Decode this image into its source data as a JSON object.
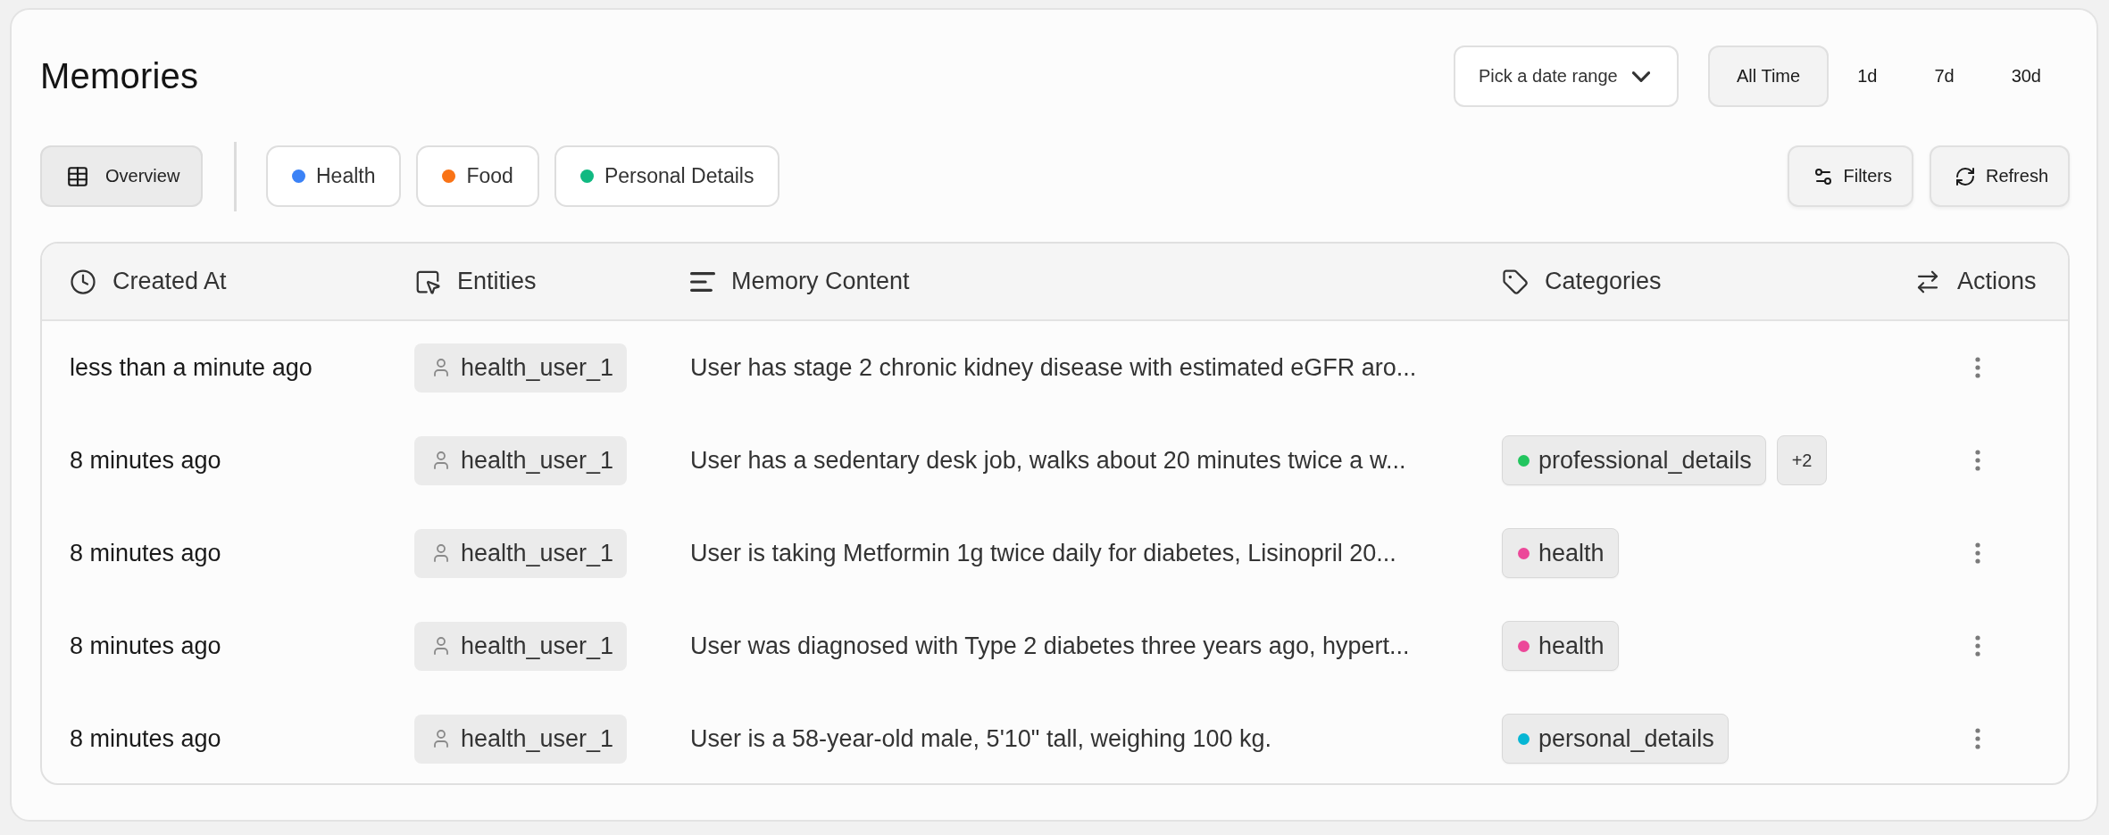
{
  "header": {
    "title": "Memories",
    "date_picker": {
      "placeholder": "Pick a date range"
    },
    "time_ranges": [
      {
        "label": "All Time",
        "selected": true
      },
      {
        "label": "1d",
        "selected": false
      },
      {
        "label": "7d",
        "selected": false
      },
      {
        "label": "30d",
        "selected": false
      }
    ]
  },
  "toolbar": {
    "overview": {
      "label": "Overview",
      "selected": true
    },
    "category_filters": [
      {
        "label": "Health",
        "color": "#3b82f6",
        "selected": false
      },
      {
        "label": "Food",
        "color": "#f97316",
        "selected": false
      },
      {
        "label": "Personal Details",
        "color": "#10b981",
        "selected": false
      }
    ],
    "actions": [
      {
        "kind": "filters",
        "label": "Filters"
      },
      {
        "kind": "refresh",
        "label": "Refresh"
      }
    ]
  },
  "table": {
    "columns": [
      {
        "kind": "time",
        "label": "Created At"
      },
      {
        "kind": "entity",
        "label": "Entities"
      },
      {
        "kind": "content",
        "label": "Memory Content"
      },
      {
        "kind": "category",
        "label": "Categories"
      },
      {
        "kind": "actions",
        "label": "Actions"
      }
    ],
    "rows": [
      {
        "created_at": "less than a minute ago",
        "entity": "health_user_1",
        "content": "User has stage 2 chronic kidney disease with estimated eGFR aro..."
      },
      {
        "created_at": "8 minutes ago",
        "entity": "health_user_1",
        "content": "User has a sedentary desk job, walks about 20 minutes twice a w...",
        "categories": [
          {
            "label": "professional_details",
            "color": "#22c55e"
          }
        ],
        "more": "+2"
      },
      {
        "created_at": "8 minutes ago",
        "entity": "health_user_1",
        "content": "User is taking Metformin 1g twice daily for diabetes, Lisinopril 20...",
        "categories": [
          {
            "label": "health",
            "color": "#ec4899"
          }
        ]
      },
      {
        "created_at": "8 minutes ago",
        "entity": "health_user_1",
        "content": "User was diagnosed with Type 2 diabetes three years ago, hypert...",
        "categories": [
          {
            "label": "health",
            "color": "#ec4899"
          }
        ]
      },
      {
        "created_at": "8 minutes ago",
        "entity": "health_user_1",
        "content": "User is a 58-year-old male, 5'10\" tall, weighing 100 kg.",
        "categories": [
          {
            "label": "personal_details",
            "color": "#06b6d4"
          }
        ]
      }
    ]
  }
}
